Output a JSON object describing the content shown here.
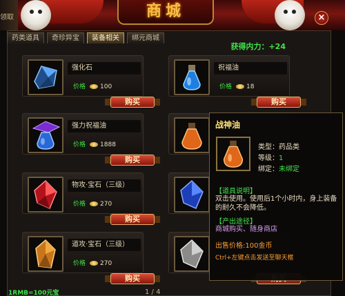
{
  "header": {
    "title": "商城",
    "left_edge_text": "领取",
    "close_label": "×"
  },
  "tabs": [
    {
      "label": "药类道具",
      "active": false
    },
    {
      "label": "奇珍异宝",
      "active": false
    },
    {
      "label": "装备相关",
      "active": true
    },
    {
      "label": "绑元商城",
      "active": false
    }
  ],
  "inner_power": "获得内力：+24",
  "price_label": "价格",
  "buy_label": "购买",
  "items": [
    {
      "name": "强化石",
      "price": "100",
      "icon": "crystal-icon",
      "color": "#4aa8ff"
    },
    {
      "name": "祝福油",
      "price": "18",
      "icon": "blue-potion-icon",
      "color": "#2e8bff"
    },
    {
      "name": "强力祝福油",
      "price": "1888",
      "icon": "purple-potion-icon",
      "color": "#9b4dff"
    },
    {
      "name": "战神油",
      "price": "",
      "icon": "orange-potion-icon",
      "color": "#ff8a1a"
    },
    {
      "name": "物攻·宝石（三级）",
      "price": "270",
      "icon": "red-gem-icon",
      "color": "#e2343a"
    },
    {
      "name": "",
      "price": "",
      "icon": "blue-gem-icon",
      "color": "#3a6cff"
    },
    {
      "name": "道攻·宝石（三级）",
      "price": "270",
      "icon": "orange-gem-icon",
      "color": "#e89a2a"
    },
    {
      "name": "",
      "price": "",
      "icon": "grey-gem-icon",
      "color": "#b8b8b8"
    }
  ],
  "footer": {
    "exchange_rate": "1RMB=100元宝",
    "pager": "1 / 4"
  },
  "tooltip": {
    "title": "战神油",
    "type_label": "类型：",
    "type_value": "药品类",
    "level_label": "等级：",
    "level_value": "1",
    "bind_label": "绑定：",
    "bind_value": "未绑定",
    "desc_header": "【道具说明】",
    "desc_text": "双击使用。使用后1个小时内，身上装备的耐久不会降低。",
    "source_header": "【产出途径】",
    "source_text": "商城购买、随身商店",
    "sell_price": "出售价格:100金币",
    "hint": "Ctrl+左键点击发送至聊天框"
  }
}
